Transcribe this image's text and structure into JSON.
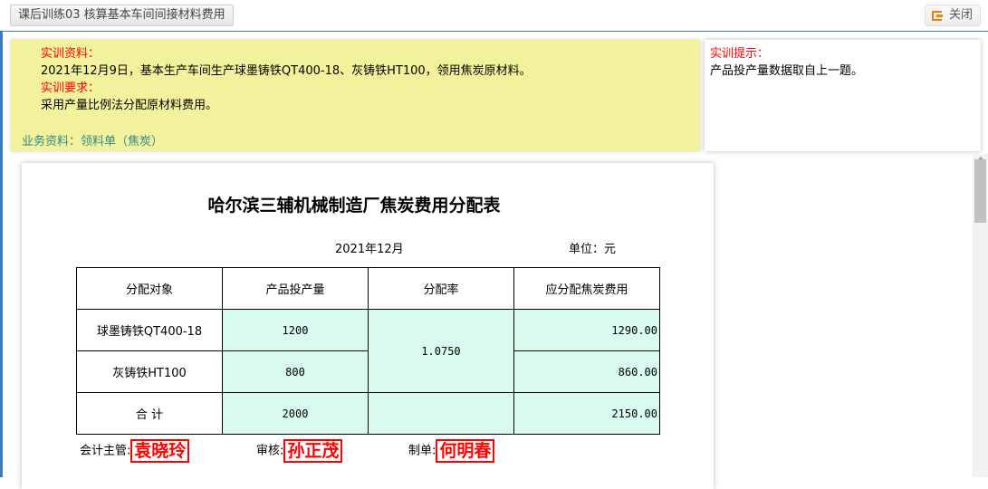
{
  "tab_title": "课后训练03 核算基本车间间接材料费用",
  "close_label": "关闭",
  "info": {
    "material_label": "实训资料：",
    "material_text": "2021年12月9日，基本生产车间生产球墨铸铁QT400-18、灰铸铁HT100，领用焦炭原材料。",
    "req_label": "实训要求：",
    "req_text": "采用产量比例法分配原材料费用。",
    "biz_link": "业务资料：领料单（焦炭）"
  },
  "hint": {
    "label": "实训提示：",
    "text": "产品投产量数据取自上一题。"
  },
  "doc": {
    "title": "哈尔滨三辅机械制造厂焦炭费用分配表",
    "date": "2021年12月",
    "unit": "单位：元",
    "headers": [
      "分配对象",
      "产品投产量",
      "分配率",
      "应分配焦炭费用"
    ],
    "rows": [
      {
        "name": "球墨铸铁QT400-18",
        "qty": "1200",
        "cost": "1290.00"
      },
      {
        "name": "灰铸铁HT100",
        "qty": "800",
        "cost": "860.00"
      }
    ],
    "rate": "1.0750",
    "total": {
      "name": "合 计",
      "qty": "2000",
      "rate": "",
      "cost": "2150.00"
    },
    "sign": [
      {
        "label": "会计主管:",
        "name": "袁晓玲"
      },
      {
        "label": "审核:",
        "name": "孙正茂"
      },
      {
        "label": "制单:",
        "name": "何明春"
      }
    ]
  }
}
